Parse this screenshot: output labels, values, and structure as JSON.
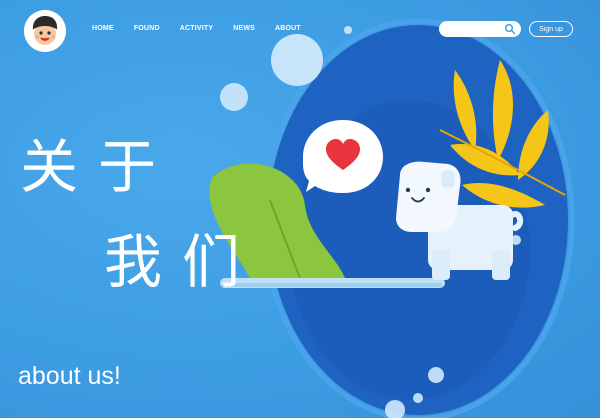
{
  "nav": {
    "items": [
      {
        "label": "HOME"
      },
      {
        "label": "FOUND"
      },
      {
        "label": "ACTIVITY"
      },
      {
        "label": "NEWS"
      },
      {
        "label": "ABOUT"
      }
    ]
  },
  "header": {
    "search_placeholder": "",
    "signup_label": "Sign up"
  },
  "hero": {
    "title_line1": "关于",
    "title_line2": "我们",
    "subtitle": "about us!"
  },
  "colors": {
    "background": "#3d9de3",
    "oval": "#1f63c2",
    "accent_green": "#8cc63f",
    "accent_yellow": "#f5c518",
    "heart": "#e8343c"
  },
  "icons": {
    "logo": "cartoon-face-icon",
    "search": "search-icon"
  }
}
